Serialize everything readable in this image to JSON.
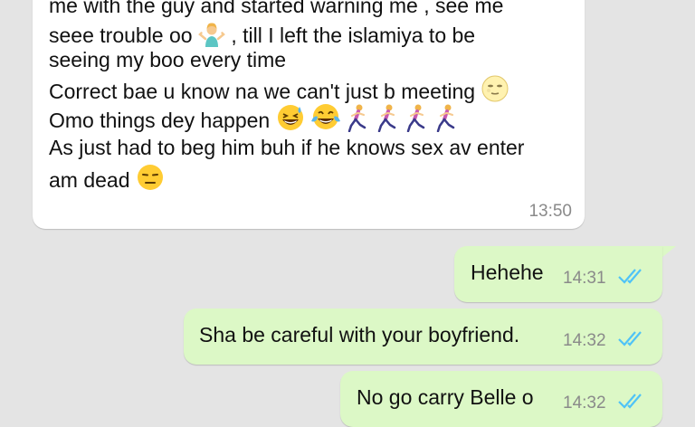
{
  "incoming_message": {
    "lines": [
      "me with the guy and started warning me , see me",
      "seee trouble oo",
      ", till I left the islamiya to be",
      "seeing my boo every time",
      "Correct bae u know na we can't just b meeting",
      "Omo things dey happen",
      "As just had to beg him buh if he knows sex av enter",
      "am dead"
    ],
    "time": "13:50"
  },
  "outgoing_messages": [
    {
      "text": "Hehehe",
      "time": "14:31"
    },
    {
      "text": "Sha be careful with your boyfriend.",
      "time": "14:32"
    },
    {
      "text": "No go carry Belle o",
      "time": "14:32"
    }
  ],
  "colors": {
    "background": "#e4e4e4",
    "incoming_bubble": "#ffffff",
    "outgoing_bubble": "#dcf8c6",
    "read_ticks": "#4fc3f7"
  },
  "emoji_names": [
    "person-shrugging-emoji",
    "slight-smile-emoji",
    "grinning-sweat-emoji",
    "tears-of-joy-emoji",
    "woman-running-emoji",
    "expressionless-emoji"
  ]
}
